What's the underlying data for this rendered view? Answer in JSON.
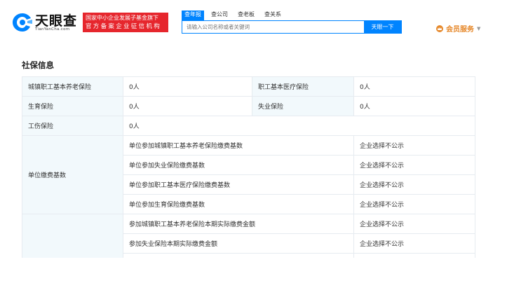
{
  "header": {
    "logo_name": "天眼查",
    "logo_domain": "TianYanCha.com",
    "badge_line1": "国家中小企业发展子基金旗下",
    "badge_line2": "官方备案企业征信机构",
    "tabs": [
      "查年报",
      "查公司",
      "查老板",
      "查关系"
    ],
    "search_placeholder": "请输入公司名称或者关键词",
    "search_button": "天眼一下",
    "vip_label": "会员服务",
    "colors": {
      "brand_blue": "#0084ff",
      "badge_red": "#e6262d",
      "vip_orange": "#e6882a"
    }
  },
  "section": {
    "title": "社保信息",
    "rows": [
      {
        "label1": "城镇职工基本养老保险",
        "value1": "0人",
        "label2": "职工基本医疗保险",
        "value2": "0人"
      },
      {
        "label1": "生育保险",
        "value1": "0人",
        "label2": "失业保险",
        "value2": "0人"
      },
      {
        "label1": "工伤保险",
        "value1": "0人"
      }
    ],
    "payment_base": {
      "label": "单位缴费基数",
      "items": [
        {
          "item": "单位参加城镇职工基本养老保险缴费基数",
          "value": "企业选择不公示"
        },
        {
          "item": "单位参加失业保险缴费基数",
          "value": "企业选择不公示"
        },
        {
          "item": "单位参加职工基本医疗保险缴费基数",
          "value": "企业选择不公示"
        },
        {
          "item": "单位参加生育保险缴费基数",
          "value": "企业选择不公示"
        }
      ]
    },
    "actual_payment": {
      "items": [
        {
          "item": "参加城镇职工基本养老保险本期实际缴费金额",
          "value": "企业选择不公示"
        },
        {
          "item": "参加失业保险本期实际缴费金额",
          "value": "企业选择不公示"
        }
      ]
    }
  }
}
